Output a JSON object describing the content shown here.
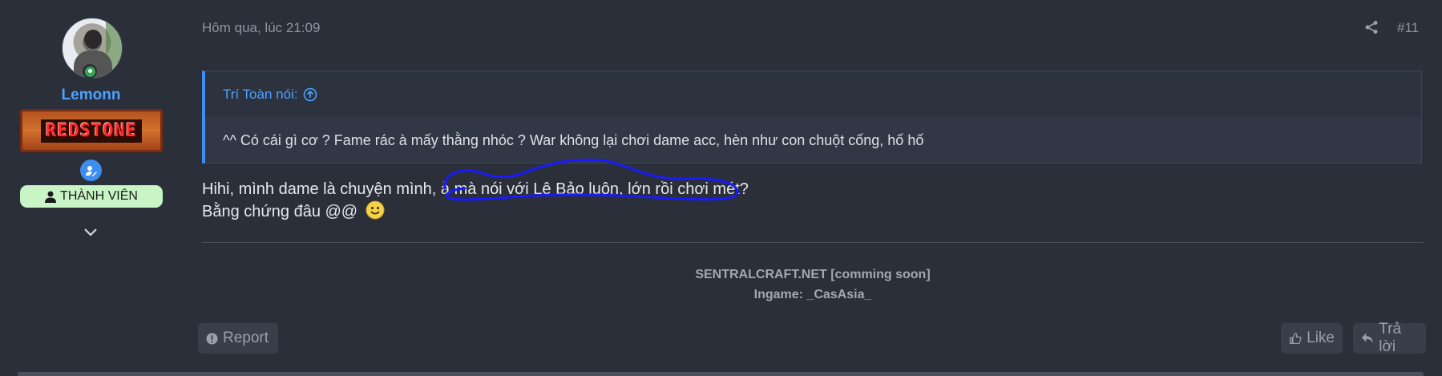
{
  "user": {
    "username": "Lemonn",
    "banner_text": "REDSTONE",
    "role": "THÀNH VIÊN",
    "online_color": "#34a853",
    "username_color": "#4da3ff"
  },
  "post": {
    "timestamp": "Hôm qua, lúc 21:09",
    "post_number": "#11",
    "quote": {
      "author": "Trí Toàn nói:",
      "text": "^^ Có cái gì cơ ? Fame rác à mấy thằng nhóc ? War không lại chơi dame acc, hèn như con chuột cống, hố hố"
    },
    "message_line1": "Hihi, mình dame là chuyện mình, à mà nói với Lê Bảo luôn, lớn rồi chơi mét?",
    "message_line2": "Bằng chứng đâu @@",
    "signature_line1": "SENTRALCRAFT.NET [comming soon]",
    "signature_line2": "Ingame: _CasAsia_"
  },
  "actions": {
    "report_label": "Report",
    "like_label": "Like",
    "reply_label": "Trả lời"
  },
  "colors": {
    "background": "#2a2f3a",
    "accent": "#3d8ef0",
    "annotation_scribble": "#1a1aff"
  }
}
